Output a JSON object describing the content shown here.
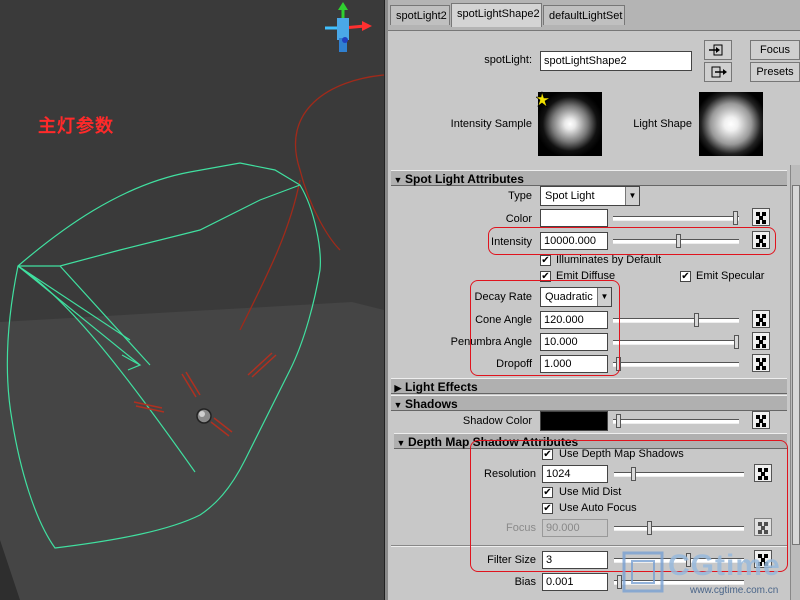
{
  "viewport": {
    "caption": "主灯参数",
    "axis_colors": {
      "x": "#ff3030",
      "y": "#30d030",
      "z": "#3060ff"
    }
  },
  "tabs": [
    {
      "label": "spotLight2",
      "active": false
    },
    {
      "label": "spotLightShape2",
      "active": true
    },
    {
      "label": "defaultLightSet",
      "active": false
    }
  ],
  "header": {
    "node_label": "spotLight:",
    "node_value": "spotLightShape2",
    "focus_label": "Focus",
    "presets_label": "Presets",
    "intensity_sample_label": "Intensity Sample",
    "light_shape_label": "Light Shape"
  },
  "spot_light_attributes": {
    "title": "Spot Light Attributes",
    "type_label": "Type",
    "type_value": "Spot Light",
    "color_label": "Color",
    "color_value": "#ffffff",
    "intensity_label": "Intensity",
    "intensity_value": "10000.000",
    "illuminates_label": "Illuminates by Default",
    "illuminates_checked": true,
    "emit_diffuse_label": "Emit Diffuse",
    "emit_diffuse_checked": true,
    "emit_specular_label": "Emit Specular",
    "emit_specular_checked": true,
    "decay_label": "Decay Rate",
    "decay_value": "Quadratic",
    "cone_label": "Cone Angle",
    "cone_value": "120.000",
    "penumbra_label": "Penumbra Angle",
    "penumbra_value": "10.000",
    "dropoff_label": "Dropoff",
    "dropoff_value": "1.000"
  },
  "light_effects": {
    "title": "Light Effects"
  },
  "shadows": {
    "title": "Shadows",
    "shadow_color_label": "Shadow Color",
    "shadow_color_value": "#000000"
  },
  "depth_map": {
    "title": "Depth Map Shadow Attributes",
    "use_depth_label": "Use Depth Map Shadows",
    "use_depth_checked": true,
    "resolution_label": "Resolution",
    "resolution_value": "1024",
    "use_mid_label": "Use Mid Dist",
    "use_mid_checked": true,
    "use_auto_label": "Use Auto Focus",
    "use_auto_checked": true,
    "focus_label": "Focus",
    "focus_value": "90.000",
    "filter_label": "Filter Size",
    "filter_value": "3",
    "bias_label": "Bias",
    "bias_value": "0.001"
  },
  "watermark": {
    "text": "CGtime",
    "url": "www.cgtime.com.cn"
  }
}
